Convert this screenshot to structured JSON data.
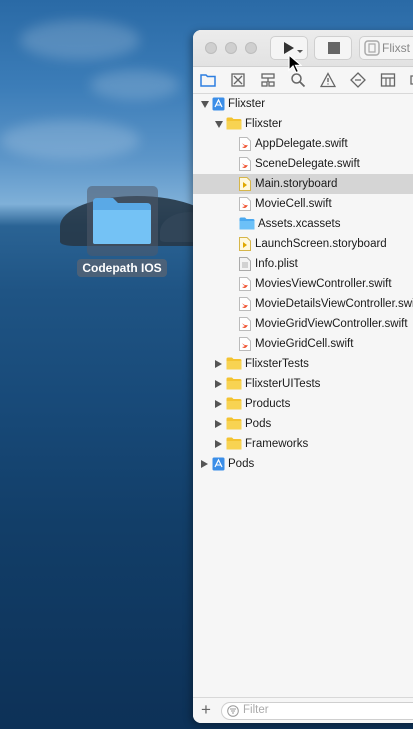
{
  "desktop": {
    "folder_label": "Codepath IOS"
  },
  "toolbar": {
    "scheme_label": "Flixst"
  },
  "navigator": {
    "tree": [
      {
        "label": "Flixster",
        "kind": "project",
        "disclosure": "open",
        "level": 0
      },
      {
        "label": "Flixster",
        "kind": "folder",
        "disclosure": "open",
        "level": 1
      },
      {
        "label": "AppDelegate.swift",
        "kind": "swift",
        "level": 2
      },
      {
        "label": "SceneDelegate.swift",
        "kind": "swift",
        "level": 2
      },
      {
        "label": "Main.storyboard",
        "kind": "storyboard",
        "level": 2,
        "selected": true
      },
      {
        "label": "MovieCell.swift",
        "kind": "swift",
        "level": 2
      },
      {
        "label": "Assets.xcassets",
        "kind": "assets",
        "level": 2
      },
      {
        "label": "LaunchScreen.storyboard",
        "kind": "storyboard",
        "level": 2
      },
      {
        "label": "Info.plist",
        "kind": "plist",
        "level": 2
      },
      {
        "label": "MoviesViewController.swift",
        "kind": "swift",
        "level": 2
      },
      {
        "label": "MovieDetailsViewController.swift",
        "kind": "swift",
        "level": 2
      },
      {
        "label": "MovieGridViewController.swift",
        "kind": "swift",
        "level": 2
      },
      {
        "label": "MovieGridCell.swift",
        "kind": "swift",
        "level": 2
      },
      {
        "label": "FlixsterTests",
        "kind": "folder",
        "disclosure": "closed",
        "level": 1
      },
      {
        "label": "FlixsterUITests",
        "kind": "folder",
        "disclosure": "closed",
        "level": 1
      },
      {
        "label": "Products",
        "kind": "folder",
        "disclosure": "closed",
        "level": 1
      },
      {
        "label": "Pods",
        "kind": "folder",
        "disclosure": "closed",
        "level": 1
      },
      {
        "label": "Frameworks",
        "kind": "folder",
        "disclosure": "closed",
        "level": 1
      },
      {
        "label": "Pods",
        "kind": "project",
        "disclosure": "closed",
        "level": 0
      }
    ]
  },
  "filter": {
    "placeholder": "Filter"
  }
}
